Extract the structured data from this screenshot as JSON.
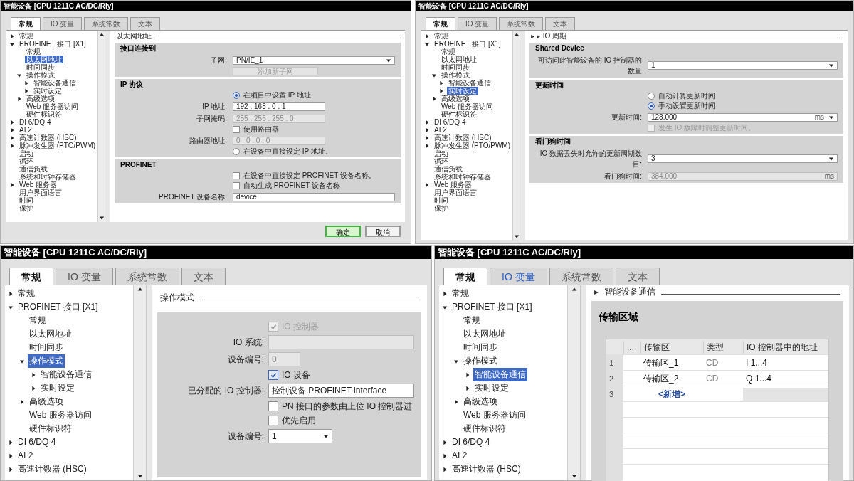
{
  "panels": [
    {
      "title": "智能设备 [CPU 1211C AC/DC/Rly]",
      "tabs": [
        {
          "label": "常规",
          "selected": true,
          "hover": false
        },
        {
          "label": "IO 变量",
          "selected": false,
          "hover": false
        },
        {
          "label": "系统常数",
          "selected": false,
          "hover": false
        },
        {
          "label": "文本",
          "selected": false,
          "hover": false
        }
      ],
      "tree": [
        {
          "label": "常规",
          "expanded": false,
          "selected": false
        },
        {
          "label": "PROFINET 接口 [X1]",
          "expanded": true,
          "selected": false,
          "children": [
            {
              "label": "常规",
              "selected": false
            },
            {
              "label": "以太网地址",
              "selected": true
            },
            {
              "label": "时间同步",
              "selected": false
            },
            {
              "label": "操作模式",
              "expanded": true,
              "selected": false,
              "children": [
                {
                  "label": "智能设备通信",
                  "expanded": false,
                  "selected": false
                },
                {
                  "label": "实时设定",
                  "expanded": false,
                  "selected": false
                }
              ]
            },
            {
              "label": "高级选项",
              "expanded": false,
              "selected": false
            },
            {
              "label": "Web 服务器访问",
              "selected": false
            },
            {
              "label": "硬件标识符",
              "selected": false
            }
          ]
        },
        {
          "label": "DI 6/DQ 4",
          "expanded": false,
          "selected": false
        },
        {
          "label": "AI 2",
          "expanded": false,
          "selected": false
        },
        {
          "label": "高速计数器 (HSC)",
          "expanded": false,
          "selected": false
        },
        {
          "label": "脉冲发生器 (PTO/PWM)",
          "expanded": false,
          "selected": false
        },
        {
          "label": "启动",
          "selected": false
        },
        {
          "label": "循环",
          "selected": false
        },
        {
          "label": "通信负载",
          "selected": false
        },
        {
          "label": "系统和时钟存储器",
          "selected": false
        },
        {
          "label": "Web 服务器",
          "expanded": false,
          "selected": false
        },
        {
          "label": "用户界面语言",
          "selected": false
        },
        {
          "label": "时间",
          "selected": false
        },
        {
          "label": "保护",
          "selected": false
        }
      ],
      "header": {
        "label": "以太网地址"
      },
      "sections": [
        {
          "title": "接口连接到",
          "rows": [
            {
              "kind": "dropdown",
              "label": "子网:",
              "value": "PN/IE_1"
            },
            {
              "kind": "button",
              "label": "添加新子网",
              "disabled": true
            }
          ]
        },
        {
          "title": "IP 协议",
          "rows": [
            {
              "kind": "radio",
              "label": "在项目中设置 IP 地址",
              "selected": true
            },
            {
              "kind": "ip",
              "label": "IP 地址:",
              "value": "192 . 168 . 0 . 1",
              "disabled": false
            },
            {
              "kind": "ip",
              "label": "子网掩码:",
              "value": "255 . 255 . 255 . 0",
              "disabled": true
            },
            {
              "kind": "checkbox",
              "label": "使用路由器",
              "checked": false,
              "disabled": false
            },
            {
              "kind": "ip",
              "label": "路由器地址:",
              "value": "0 . 0 . 0 . 0",
              "disabled": true
            },
            {
              "kind": "radio",
              "label": "在设备中直接设定 IP 地址。",
              "selected": false
            }
          ]
        },
        {
          "title": "PROFINET",
          "rows": [
            {
              "kind": "checkbox",
              "label": "在设备中直接设定 PROFINET 设备名称。",
              "checked": false,
              "disabled": false
            },
            {
              "kind": "checkbox",
              "label": "自动生成 PROFINET 设备名称",
              "checked": false,
              "disabled": false
            },
            {
              "kind": "field",
              "label": "PROFINET 设备名称:",
              "value": "device",
              "disabled": false
            }
          ]
        }
      ],
      "buttons": [
        {
          "label": "确定",
          "kind": "primary"
        },
        {
          "label": "取消",
          "kind": "default"
        }
      ]
    },
    {
      "title": "智能设备 [CPU 1211C AC/DC/Rly]",
      "tabs": [
        {
          "label": "常规",
          "selected": true,
          "hover": false
        },
        {
          "label": "IO 变量",
          "selected": false,
          "hover": false
        },
        {
          "label": "系统常数",
          "selected": false,
          "hover": false
        },
        {
          "label": "文本",
          "selected": false,
          "hover": false
        }
      ],
      "tree": [
        {
          "label": "常规",
          "expanded": false,
          "selected": false
        },
        {
          "label": "PROFINET 接口 [X1]",
          "expanded": true,
          "selected": false,
          "children": [
            {
              "label": "常规",
              "selected": false
            },
            {
              "label": "以太网地址",
              "selected": false
            },
            {
              "label": "时间同步",
              "selected": false
            },
            {
              "label": "操作模式",
              "expanded": true,
              "selected": false,
              "children": [
                {
                  "label": "智能设备通信",
                  "expanded": false,
                  "selected": false
                },
                {
                  "label": "实时设定",
                  "expanded": false,
                  "selected": true
                }
              ]
            },
            {
              "label": "高级选项",
              "expanded": false,
              "selected": false
            },
            {
              "label": "Web 服务器访问",
              "selected": false
            },
            {
              "label": "硬件标识符",
              "selected": false
            }
          ]
        },
        {
          "label": "DI 6/DQ 4",
          "expanded": false,
          "selected": false
        },
        {
          "label": "AI 2",
          "expanded": false,
          "selected": false
        },
        {
          "label": "高速计数器 (HSC)",
          "expanded": false,
          "selected": false
        },
        {
          "label": "脉冲发生器 (PTO/PWM)",
          "expanded": false,
          "selected": false
        },
        {
          "label": "启动",
          "selected": false
        },
        {
          "label": "循环",
          "selected": false
        },
        {
          "label": "通信负载",
          "selected": false
        },
        {
          "label": "系统和时钟存储器",
          "selected": false
        },
        {
          "label": "Web 服务器",
          "expanded": false,
          "selected": false
        },
        {
          "label": "用户界面语言",
          "selected": false
        },
        {
          "label": "时间",
          "selected": false
        },
        {
          "label": "保护",
          "selected": false
        }
      ],
      "header": {
        "prefix": "▸ ▸",
        "label": "IO 周期"
      },
      "sections": [
        {
          "title": "Shared Device",
          "rows": [
            {
              "kind": "dropdown",
              "label": "可访问此智能设备的 IO 控制器的数量",
              "value": "1"
            }
          ]
        },
        {
          "title": "更新时间",
          "rows": [
            {
              "kind": "radio",
              "label": "自动计算更新时间",
              "selected": false
            },
            {
              "kind": "radio",
              "label": "手动设置更新时间",
              "selected": true
            },
            {
              "kind": "dropdown",
              "label": "更新时间:",
              "value": "128.000",
              "unit": "ms"
            },
            {
              "kind": "checkbox",
              "label": "发生 IO 故障时调整更新时间。",
              "checked": false,
              "disabled": true
            }
          ]
        },
        {
          "title": "看门狗时间",
          "rows": [
            {
              "kind": "dropdown",
              "label": "IO 数据丢失时允许的更新周期数目:",
              "value": "3"
            },
            {
              "kind": "field",
              "label": "看门狗时间:",
              "value": "384.000",
              "unit": "ms",
              "disabled": true
            }
          ]
        }
      ]
    },
    {
      "title": "智能设备 [CPU 1211C AC/DC/Rly]",
      "tabs": [
        {
          "label": "常规",
          "selected": true,
          "hover": false
        },
        {
          "label": "IO 变量",
          "selected": false,
          "hover": false
        },
        {
          "label": "系统常数",
          "selected": false,
          "hover": false
        },
        {
          "label": "文本",
          "selected": false,
          "hover": false
        }
      ],
      "tree": [
        {
          "label": "常规",
          "expanded": false,
          "selected": false
        },
        {
          "label": "PROFINET 接口 [X1]",
          "expanded": true,
          "selected": false,
          "children": [
            {
              "label": "常规",
              "selected": false
            },
            {
              "label": "以太网地址",
              "selected": false
            },
            {
              "label": "时间同步",
              "selected": false
            },
            {
              "label": "操作模式",
              "expanded": true,
              "selected": true,
              "children": [
                {
                  "label": "智能设备通信",
                  "expanded": false,
                  "selected": false
                },
                {
                  "label": "实时设定",
                  "expanded": false,
                  "selected": false
                }
              ]
            },
            {
              "label": "高级选项",
              "expanded": false,
              "selected": false
            },
            {
              "label": "Web 服务器访问",
              "selected": false
            },
            {
              "label": "硬件标识符",
              "selected": false
            }
          ]
        },
        {
          "label": "DI 6/DQ 4",
          "expanded": false,
          "selected": false
        },
        {
          "label": "AI 2",
          "expanded": false,
          "selected": false
        },
        {
          "label": "高速计数器 (HSC)",
          "expanded": false,
          "selected": false
        }
      ],
      "header": {
        "label": "操作模式"
      },
      "sections": [
        {
          "rows": [
            {
              "kind": "checkbox",
              "label": "IO 控制器",
              "checked": true,
              "disabled": true
            },
            {
              "kind": "field",
              "label": "IO 系统:",
              "disabled": true
            },
            {
              "kind": "number",
              "label": "设备编号:",
              "value": "0",
              "disabled": true
            },
            {
              "kind": "checkbox",
              "label": "IO 设备",
              "checked": true,
              "disabled": false
            },
            {
              "kind": "field",
              "label": "已分配的 IO 控制器:",
              "value": "控制设备.PROFINET interface",
              "disabled": false
            },
            {
              "kind": "checkbox",
              "label": "PN 接口的参数由上位 IO 控制器进",
              "checked": false,
              "disabled": false
            },
            {
              "kind": "checkbox",
              "label": "优先启用",
              "checked": false,
              "disabled": false
            },
            {
              "kind": "number_dropdown",
              "label": "设备编号:",
              "value": "1"
            }
          ]
        }
      ]
    },
    {
      "title": "智能设备 [CPU 1211C AC/DC/Rly]",
      "tabs": [
        {
          "label": "常规",
          "selected": true,
          "hover": false
        },
        {
          "label": "IO 变量",
          "selected": false,
          "hover": true
        },
        {
          "label": "系统常数",
          "selected": false,
          "hover": false
        },
        {
          "label": "文本",
          "selected": false,
          "hover": false
        }
      ],
      "tree": [
        {
          "label": "常规",
          "expanded": false,
          "selected": false
        },
        {
          "label": "PROFINET 接口 [X1]",
          "expanded": true,
          "selected": false,
          "children": [
            {
              "label": "常规",
              "selected": false
            },
            {
              "label": "以太网地址",
              "selected": false
            },
            {
              "label": "时间同步",
              "selected": false
            },
            {
              "label": "操作模式",
              "expanded": true,
              "selected": false,
              "children": [
                {
                  "label": "智能设备通信",
                  "expanded": false,
                  "selected": true
                },
                {
                  "label": "实时设定",
                  "expanded": false,
                  "selected": false
                }
              ]
            },
            {
              "label": "高级选项",
              "expanded": false,
              "selected": false
            },
            {
              "label": "Web 服务器访问",
              "selected": false
            },
            {
              "label": "硬件标识符",
              "selected": false
            }
          ]
        },
        {
          "label": "DI 6/DQ 4",
          "expanded": false,
          "selected": false
        },
        {
          "label": "AI 2",
          "expanded": false,
          "selected": false
        },
        {
          "label": "高速计数器 (HSC)",
          "expanded": false,
          "selected": false
        }
      ],
      "header": {
        "prefix": "▸",
        "label": "智能设备通信"
      },
      "sections": [
        {
          "title": "传输区域",
          "rows": [
            {
              "kind": "table",
              "columns": [
                "...",
                "传输区",
                "类型",
                "IO 控制器中的地址"
              ],
              "rows": [
                {
                  "number": "1",
                  "name": "传输区_1",
                  "type": "CD",
                  "address": "I 1...4"
                },
                {
                  "number": "2",
                  "name": "传输区_2",
                  "type": "CD",
                  "address": "Q 1...4"
                }
              ],
              "new_row": {
                "number": "3",
                "label": "<新增>"
              }
            }
          ]
        }
      ]
    }
  ]
}
